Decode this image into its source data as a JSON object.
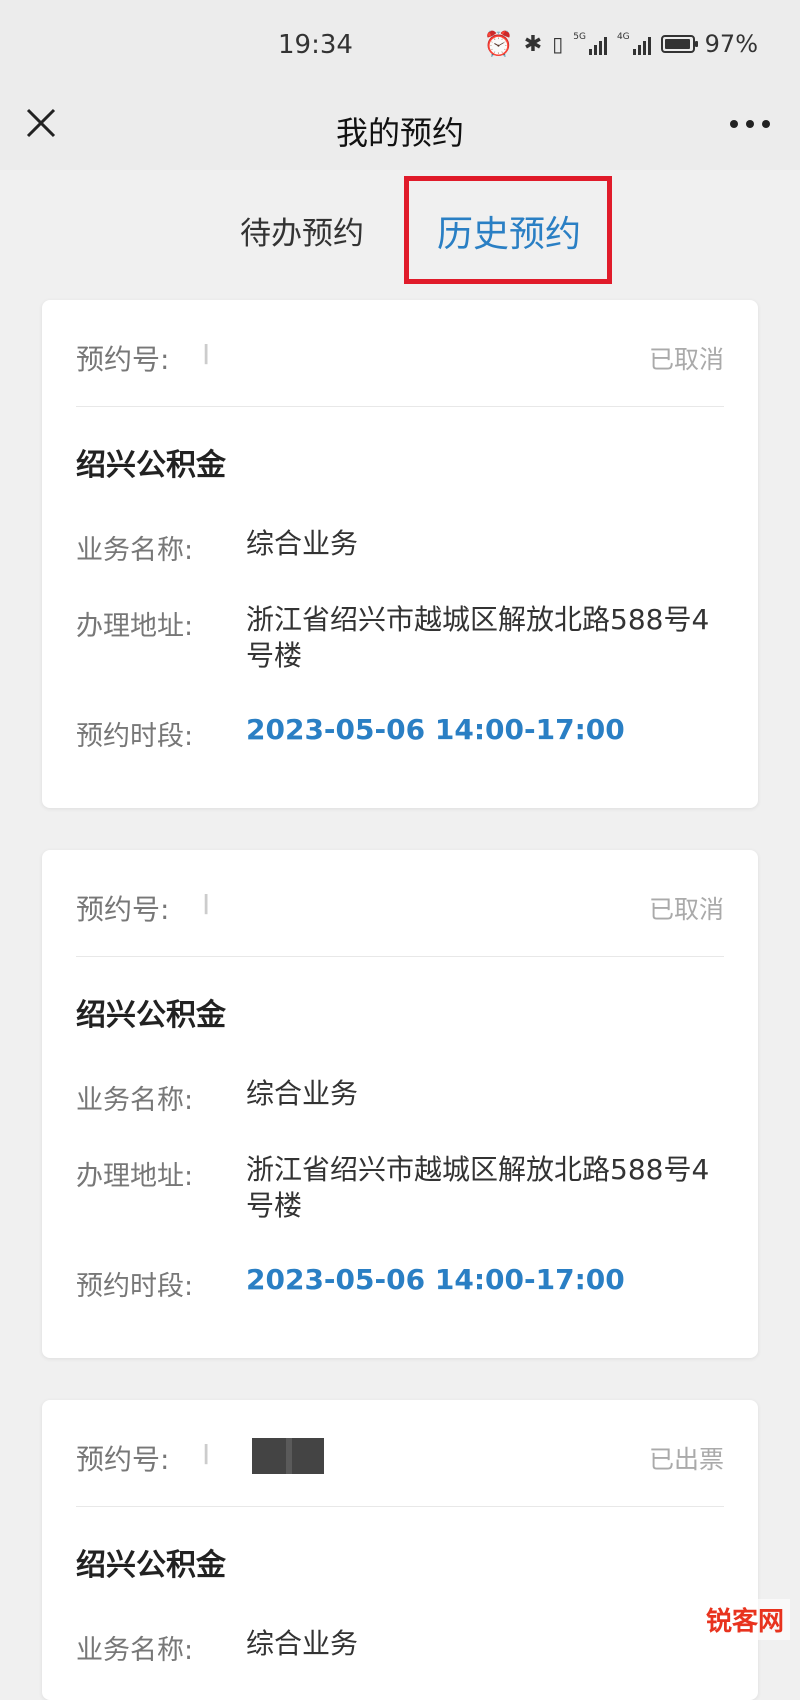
{
  "status_bar": {
    "time": "19:34",
    "battery": "97%",
    "battery_level": 0.97,
    "net1": "5G",
    "net2": "4G"
  },
  "nav": {
    "title": "我的预约"
  },
  "tabs": [
    {
      "label": "待办预约",
      "active": false
    },
    {
      "label": "历史预约",
      "active": true
    }
  ],
  "colors": {
    "accent": "#2a7fc4",
    "highlight_box": "#e01b2a",
    "watermark": "#e8331e"
  },
  "labels": {
    "number": "预约号:",
    "business_name": "业务名称:",
    "address": "办理地址:",
    "time_slot": "预约时段:"
  },
  "appointments": [
    {
      "number": "I",
      "status": "已取消",
      "org": "绍兴公积金",
      "business_name": "综合业务",
      "address": "浙江省绍兴市越城区解放北路588号4号楼",
      "time_slot": "2023-05-06 14:00-17:00"
    },
    {
      "number": "I",
      "status": "已取消",
      "org": "绍兴公积金",
      "business_name": "综合业务",
      "address": "浙江省绍兴市越城区解放北路588号4号楼",
      "time_slot": "2023-05-06 14:00-17:00"
    },
    {
      "number": "I",
      "status": "已出票",
      "org": "绍兴公积金",
      "business_name": "综合业务"
    }
  ],
  "watermark": "锐客网"
}
